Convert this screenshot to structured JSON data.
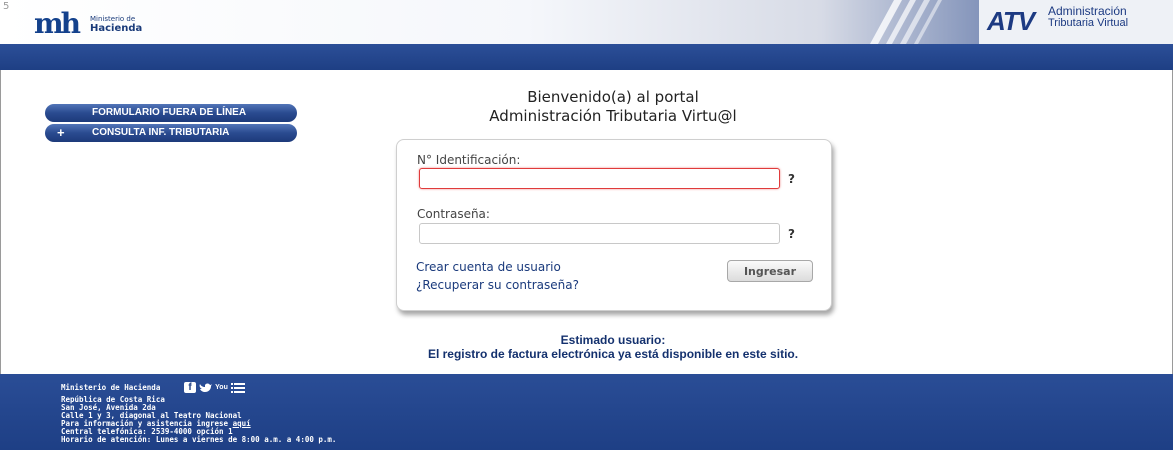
{
  "header": {
    "corner_number": "5",
    "ministry_logo_mark": "mh",
    "ministry_line1": "Ministerio de",
    "ministry_line2": "Hacienda",
    "atv_logo": "ATV",
    "atv_line1": "Administración",
    "atv_line2": "Tributaria Virtual"
  },
  "sidebar": {
    "items": [
      {
        "label": "FORMULARIO FUERA DE LÍNEA",
        "icon": ""
      },
      {
        "label": "CONSULTA INF. TRIBUTARIA",
        "icon": "+"
      }
    ]
  },
  "welcome": {
    "line1": "Bienvenido(a) al portal",
    "line2": "Administración Tributaria Virtu@l"
  },
  "login": {
    "id_label": "N° Identificación:",
    "id_value": "",
    "id_help": "?",
    "password_label": "Contraseña:",
    "password_value": "",
    "password_help": "?",
    "create_account": "Crear cuenta de usuario",
    "recover_password": "¿Recuperar su contraseña?",
    "submit_label": "Ingresar"
  },
  "notice": {
    "line1": "Estimado usuario:",
    "line2": "El registro de factura electrónica ya está disponible en este sitio."
  },
  "footer": {
    "title": "Ministerio de Hacienda",
    "social_icons": [
      "facebook-icon",
      "twitter-icon",
      "youtube-icon",
      "list-icon"
    ],
    "youtube_text": "You",
    "lines": [
      "República de Costa Rica",
      "San José, Avenida 2da",
      "Calle 1 y 3, diagonal al Teatro Nacional"
    ],
    "info_prefix": "Para información y asistencia ingrese ",
    "info_link": "aquí",
    "phone": "Central telefónica: 2539-4000 opción 1",
    "hours": "Horario de atención: Lunes a viernes de 8:00 a.m. a 4:00 p.m."
  },
  "colors": {
    "brand_blue": "#1e3f85",
    "link_blue": "#1a3a7c",
    "error_red": "#e03b3b"
  }
}
